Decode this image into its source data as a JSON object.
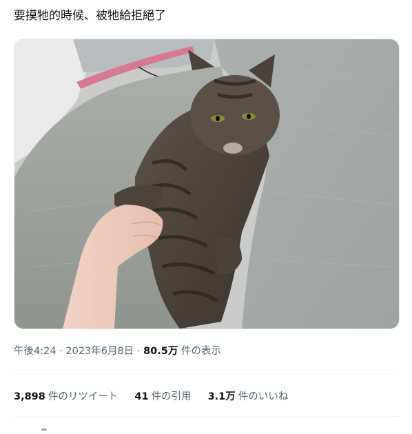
{
  "tweet": {
    "text": "要摸牠的時候、被牠給拒絕了",
    "image_alt": "Tabby cat on a sofa pushing a hand away with its paw"
  },
  "meta": {
    "time": "午後4:24",
    "sep1": " · ",
    "date": "2023年6月8日",
    "sep2": " · ",
    "views_value": "80.5万",
    "views_label": " 件の表示"
  },
  "stats": [
    {
      "value": "3,898",
      "label": "件のリツイート"
    },
    {
      "value": "41",
      "label": "件の引用"
    },
    {
      "value": "3.1万",
      "label": "件のいいね"
    }
  ],
  "colors": {
    "text": "#0f1419",
    "secondary": "#536471",
    "divider": "#eff3f4"
  }
}
